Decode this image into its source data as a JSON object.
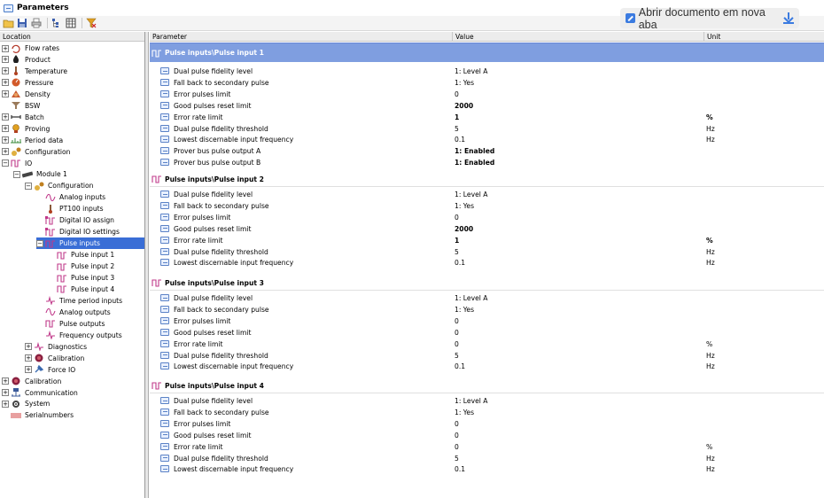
{
  "window": {
    "title": "Parameters"
  },
  "toolbar": {
    "buttons": [
      "open-icon",
      "save-icon",
      "print-icon",
      "tree-view-icon",
      "table-view-icon",
      "filter-icon"
    ]
  },
  "overlay": {
    "label": "Abrir documento em nova aba"
  },
  "tree": {
    "header": "Location",
    "items": [
      {
        "label": "Flow rates",
        "level": 0,
        "expander": "+",
        "icon": "flow-rates-icon"
      },
      {
        "label": "Product",
        "level": 0,
        "expander": "+",
        "icon": "product-icon"
      },
      {
        "label": "Temperature",
        "level": 0,
        "expander": "+",
        "icon": "temperature-icon"
      },
      {
        "label": "Pressure",
        "level": 0,
        "expander": "+",
        "icon": "pressure-icon"
      },
      {
        "label": "Density",
        "level": 0,
        "expander": "+",
        "icon": "density-icon"
      },
      {
        "label": "BSW",
        "level": 0,
        "expander": "",
        "icon": "bsw-icon"
      },
      {
        "label": "Batch",
        "level": 0,
        "expander": "+",
        "icon": "batch-icon"
      },
      {
        "label": "Proving",
        "level": 0,
        "expander": "+",
        "icon": "proving-icon"
      },
      {
        "label": "Period data",
        "level": 0,
        "expander": "+",
        "icon": "period-data-icon"
      },
      {
        "label": "Configuration",
        "level": 0,
        "expander": "+",
        "icon": "configuration-icon"
      },
      {
        "label": "IO",
        "level": 0,
        "expander": "−",
        "icon": "io-icon"
      },
      {
        "label": "Module 1",
        "level": 1,
        "expander": "−",
        "icon": "module-icon"
      },
      {
        "label": "Configuration",
        "level": 2,
        "expander": "−",
        "icon": "configuration-icon"
      },
      {
        "label": "Analog inputs",
        "level": 3,
        "expander": "",
        "icon": "analog-inputs-icon"
      },
      {
        "label": "PT100 inputs",
        "level": 3,
        "expander": "",
        "icon": "pt100-icon"
      },
      {
        "label": "Digital IO assign",
        "level": 3,
        "expander": "",
        "icon": "digital-io-icon"
      },
      {
        "label": "Digital IO settings",
        "level": 3,
        "expander": "",
        "icon": "digital-io-icon"
      },
      {
        "label": "Pulse inputs",
        "level": 3,
        "expander": "−",
        "icon": "pulse-icon",
        "selected": true
      },
      {
        "label": "Pulse input 1",
        "level": 4,
        "expander": "",
        "icon": "pulse-icon"
      },
      {
        "label": "Pulse input 2",
        "level": 4,
        "expander": "",
        "icon": "pulse-icon"
      },
      {
        "label": "Pulse input 3",
        "level": 4,
        "expander": "",
        "icon": "pulse-icon"
      },
      {
        "label": "Pulse input 4",
        "level": 4,
        "expander": "",
        "icon": "pulse-icon"
      },
      {
        "label": "Time period inputs",
        "level": 3,
        "expander": "",
        "icon": "time-period-icon"
      },
      {
        "label": "Analog outputs",
        "level": 3,
        "expander": "",
        "icon": "analog-outputs-icon"
      },
      {
        "label": "Pulse outputs",
        "level": 3,
        "expander": "",
        "icon": "pulse-icon"
      },
      {
        "label": "Frequency outputs",
        "level": 3,
        "expander": "",
        "icon": "frequency-icon"
      },
      {
        "label": "Diagnostics",
        "level": 2,
        "expander": "+",
        "icon": "diagnostics-icon"
      },
      {
        "label": "Calibration",
        "level": 2,
        "expander": "+",
        "icon": "calibration-icon"
      },
      {
        "label": "Force IO",
        "level": 2,
        "expander": "+",
        "icon": "force-io-icon"
      },
      {
        "label": "Calibration",
        "level": 0,
        "expander": "+",
        "icon": "calibration-icon"
      },
      {
        "label": "Communication",
        "level": 0,
        "expander": "+",
        "icon": "communication-icon"
      },
      {
        "label": "System",
        "level": 0,
        "expander": "+",
        "icon": "system-icon"
      },
      {
        "label": "Serialnumbers",
        "level": 0,
        "expander": "",
        "icon": "serialnumbers-icon"
      }
    ]
  },
  "grid": {
    "columns": {
      "parameter": "Parameter",
      "value": "Value",
      "unit": "Unit"
    },
    "sections": [
      {
        "title": "Pulse inputs\\Pulse input 1",
        "active": true,
        "rows": [
          {
            "name": "Dual pulse fidelity level",
            "value": "1: Level A",
            "unit": "",
            "bold": false
          },
          {
            "name": "Fall back to secondary pulse",
            "value": "1: Yes",
            "unit": "",
            "bold": false
          },
          {
            "name": "Error pulses limit",
            "value": "0",
            "unit": "",
            "bold": false
          },
          {
            "name": "Good pulses reset limit",
            "value": "2000",
            "unit": "",
            "bold": true
          },
          {
            "name": "Error rate limit",
            "value": "1",
            "unit": "%",
            "bold": true
          },
          {
            "name": "Dual pulse fidelity threshold",
            "value": "5",
            "unit": "Hz",
            "bold": false
          },
          {
            "name": "Lowest discernable input frequency",
            "value": "0.1",
            "unit": "Hz",
            "bold": false
          },
          {
            "name": "Prover bus pulse output A",
            "value": "1: Enabled",
            "unit": "",
            "bold": true
          },
          {
            "name": "Prover bus pulse output B",
            "value": "1: Enabled",
            "unit": "",
            "bold": true
          }
        ]
      },
      {
        "title": "Pulse inputs\\Pulse input 2",
        "active": false,
        "rows": [
          {
            "name": "Dual pulse fidelity level",
            "value": "1: Level A",
            "unit": "",
            "bold": false
          },
          {
            "name": "Fall back to secondary pulse",
            "value": "1: Yes",
            "unit": "",
            "bold": false
          },
          {
            "name": "Error pulses limit",
            "value": "0",
            "unit": "",
            "bold": false
          },
          {
            "name": "Good pulses reset limit",
            "value": "2000",
            "unit": "",
            "bold": true
          },
          {
            "name": "Error rate limit",
            "value": "1",
            "unit": "%",
            "bold": true
          },
          {
            "name": "Dual pulse fidelity threshold",
            "value": "5",
            "unit": "Hz",
            "bold": false
          },
          {
            "name": "Lowest discernable input frequency",
            "value": "0.1",
            "unit": "Hz",
            "bold": false
          }
        ]
      },
      {
        "title": "Pulse inputs\\Pulse input 3",
        "active": false,
        "rows": [
          {
            "name": "Dual pulse fidelity level",
            "value": "1: Level A",
            "unit": "",
            "bold": false
          },
          {
            "name": "Fall back to secondary pulse",
            "value": "1: Yes",
            "unit": "",
            "bold": false
          },
          {
            "name": "Error pulses limit",
            "value": "0",
            "unit": "",
            "bold": false
          },
          {
            "name": "Good pulses reset limit",
            "value": "0",
            "unit": "",
            "bold": false
          },
          {
            "name": "Error rate limit",
            "value": "0",
            "unit": "%",
            "bold": false
          },
          {
            "name": "Dual pulse fidelity threshold",
            "value": "5",
            "unit": "Hz",
            "bold": false
          },
          {
            "name": "Lowest discernable input frequency",
            "value": "0.1",
            "unit": "Hz",
            "bold": false
          }
        ]
      },
      {
        "title": "Pulse inputs\\Pulse input 4",
        "active": false,
        "rows": [
          {
            "name": "Dual pulse fidelity level",
            "value": "1: Level A",
            "unit": "",
            "bold": false
          },
          {
            "name": "Fall back to secondary pulse",
            "value": "1: Yes",
            "unit": "",
            "bold": false
          },
          {
            "name": "Error pulses limit",
            "value": "0",
            "unit": "",
            "bold": false
          },
          {
            "name": "Good pulses reset limit",
            "value": "0",
            "unit": "",
            "bold": false
          },
          {
            "name": "Error rate limit",
            "value": "0",
            "unit": "%",
            "bold": false
          },
          {
            "name": "Dual pulse fidelity threshold",
            "value": "5",
            "unit": "Hz",
            "bold": false
          },
          {
            "name": "Lowest discernable input frequency",
            "value": "0.1",
            "unit": "Hz",
            "bold": false
          }
        ]
      }
    ]
  },
  "colors": {
    "selection": "#3a6ed6",
    "active_section": "#7f9ee0",
    "pulse_icon": "#c0398a"
  }
}
